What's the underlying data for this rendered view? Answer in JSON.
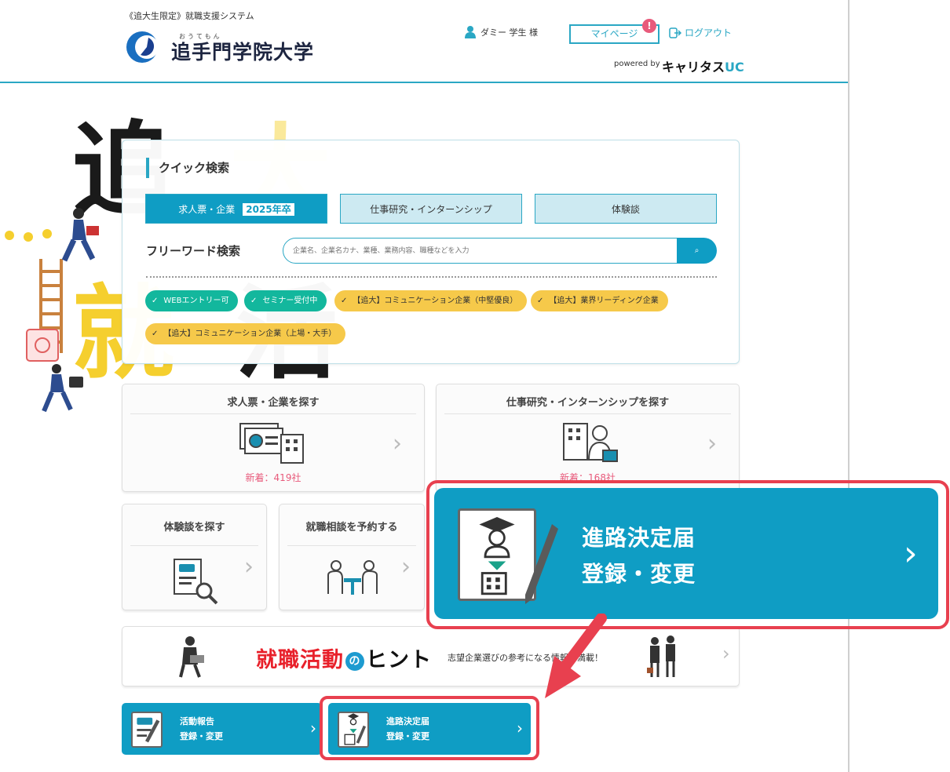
{
  "header": {
    "system_name": "《追大生限定》就職支援システム",
    "university_ruby": "おうてもん",
    "university_name": "追手門学院大学",
    "user_name": "ダミー 学生 様",
    "mypage_label": "マイページ",
    "notice_badge": "!",
    "logout_label": "ログアウト",
    "powered_by": "powered by",
    "provider_name_main": "キャリタス",
    "provider_name_accent": "UC"
  },
  "quick_search": {
    "title": "クイック検索",
    "tabs": [
      {
        "label": "求人票・企業",
        "badge": "2025年卒"
      },
      {
        "label": "仕事研究・インターンシップ"
      },
      {
        "label": "体験談"
      }
    ],
    "freeword_label": "フリーワード検索",
    "search_placeholder": "企業名、企業名カナ、業種、業務内容、職種などを入力",
    "search_button": "⌕",
    "tags": [
      {
        "label": "WEBエントリー可",
        "color": "#13b79d"
      },
      {
        "label": "セミナー受付中",
        "color": "#13b79d"
      },
      {
        "label": "【追大】コミュニケーション企業（中堅優良）",
        "color": "#f6c94a"
      },
      {
        "label": "【追大】業界リーディング企業",
        "color": "#f6c94a"
      },
      {
        "label": "【追大】コミュニケーション企業（上場・大手）",
        "color": "#f6c94a"
      }
    ]
  },
  "menu": {
    "jobs": {
      "title": "求人票・企業を探す",
      "new_count": "新着：419社"
    },
    "research": {
      "title": "仕事研究・インターンシップを探す",
      "new_count": "新着：168社"
    },
    "experience": {
      "title": "体験談を探す"
    },
    "consult": {
      "title": "就職相談を予約する"
    }
  },
  "big_banner": {
    "line1": "進路決定届",
    "line2": "登録・変更"
  },
  "hint": {
    "title_part1": "就職活動",
    "title_part2": "の",
    "title_part3": "ヒント",
    "subtitle": "志望企業選びの参考になる情報が満載！"
  },
  "bottom": {
    "report": {
      "line1": "活動報告",
      "line2": "登録・変更"
    },
    "decision": {
      "line1": "進路決定届",
      "line2": "登録・変更"
    }
  },
  "hero": {
    "chars": [
      "追",
      "大",
      "就",
      "活"
    ]
  },
  "colors": {
    "accent": "#0f9dc4",
    "highlight": "#e8404f",
    "green_tag": "#13b79d",
    "yellow_tag": "#f6c94a"
  }
}
